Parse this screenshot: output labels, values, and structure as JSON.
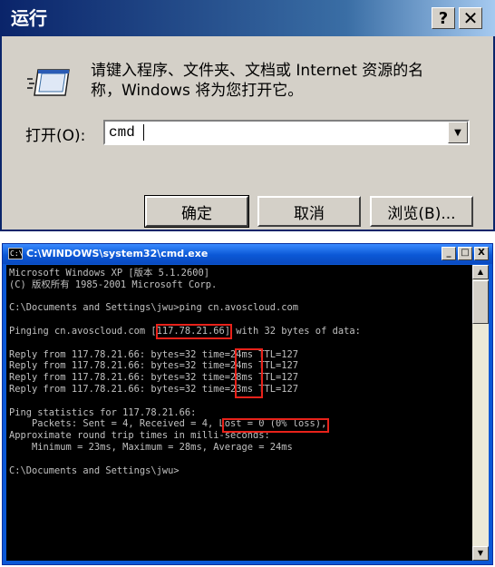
{
  "run_dialog": {
    "title": "运行",
    "help_glyph": "?",
    "close_glyph": "✕",
    "prompt_line1": "请键入程序、文件夹、文档或 Internet 资源的名",
    "prompt_line2": "称，Windows 将为您打开它。",
    "open_label": "打开(O):",
    "open_value": "cmd",
    "dropdown_glyph": "▼",
    "ok_label": "确定",
    "cancel_label": "取消",
    "browse_label": "浏览(B)..."
  },
  "cmd_window": {
    "title": "C:\\WINDOWS\\system32\\cmd.exe",
    "title_icon_text": "C:\\",
    "controls": {
      "minimize": "_",
      "maximize": "□",
      "close": "X"
    },
    "scroll_up": "▲",
    "scroll_down": "▼",
    "lines": [
      "Microsoft Windows XP [版本 5.1.2600]",
      "(C) 版权所有 1985-2001 Microsoft Corp.",
      "",
      "C:\\Documents and Settings\\jwu>ping cn.avoscloud.com",
      "",
      "Pinging cn.avoscloud.com [117.78.21.66] with 32 bytes of data:",
      "",
      "Reply from 117.78.21.66: bytes=32 time=24ms TTL=127",
      "Reply from 117.78.21.66: bytes=32 time=24ms TTL=127",
      "Reply from 117.78.21.66: bytes=32 time=28ms TTL=127",
      "Reply from 117.78.21.66: bytes=32 time=23ms TTL=127",
      "",
      "Ping statistics for 117.78.21.66:",
      "    Packets: Sent = 4, Received = 4, Lost = 0 (0% loss),",
      "Approximate round trip times in milli-seconds:",
      "    Minimum = 23ms, Maximum = 28ms, Average = 24ms",
      "",
      "C:\\Documents and Settings\\jwu>"
    ]
  },
  "colors": {
    "highlight_box": "#e8221a",
    "console_text": "#c0c0c0",
    "console_bg": "#000000",
    "cmd_titlebar": "#0b58d6",
    "run_titlebar": "#0a246a"
  }
}
